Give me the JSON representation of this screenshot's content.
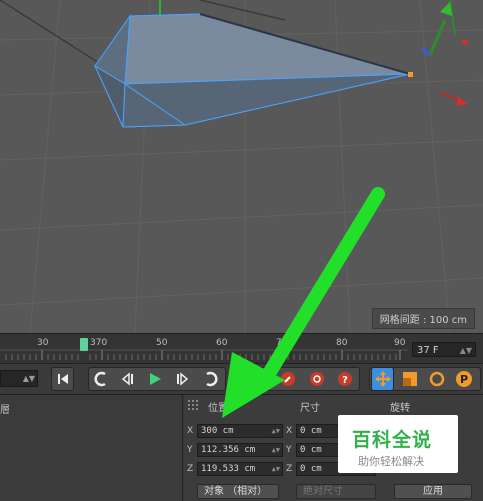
{
  "viewport": {
    "grid_spacing_label": "网格间距 : 100 cm"
  },
  "timeline": {
    "ticks": [
      "30",
      "370",
      "50",
      "60",
      "70",
      "80",
      "90"
    ],
    "current_frame": "37 F"
  },
  "transport": {
    "buttons": [
      "go-to-start",
      "record-key",
      "previous-key",
      "play",
      "next-key",
      "autokey",
      "move-tool",
      "scale-tool",
      "rotate-tool",
      "parametric-tool"
    ]
  },
  "object_panel": {
    "label": "層"
  },
  "attributes": {
    "headers": {
      "position": "位置",
      "size": "尺寸",
      "rotation": "旋转"
    },
    "position": {
      "x": "300 cm",
      "y": "112.356 cm",
      "z": "119.533 cm"
    },
    "size": {
      "x": "0 cm",
      "y": "0 cm",
      "z": "0 cm"
    },
    "axes": {
      "x": "X",
      "y": "Y",
      "z": "Z"
    },
    "coord_mode": "对象 （相对）",
    "size_mode": "绝对尺寸",
    "apply_label": "应用"
  },
  "watermark": {
    "title": "百科全说",
    "subtitle": "助你轻松解决"
  },
  "colors": {
    "viewport_bg": "#585858",
    "mesh_fill": "#6d7f92",
    "mesh_edge": "#4aa3ff",
    "arrow": "#22e02a",
    "playhead": "#5ed39a",
    "orange_accent": "#f29a2b"
  }
}
